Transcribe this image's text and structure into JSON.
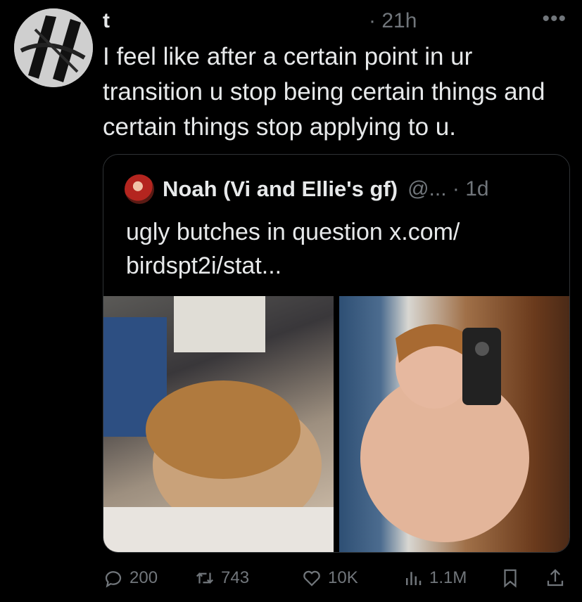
{
  "tweet": {
    "author_name": "t",
    "time": "· 21h",
    "text": "I feel like after a certain point in ur transition u stop being certain things and certain things stop applying to u.",
    "more_icon": "more-icon"
  },
  "quoted": {
    "author_name": "Noah (Vi and Ellie's gf)",
    "handle_time": "@... · 1d",
    "text": "ugly butches in question x.com/ birdspt2i/stat..."
  },
  "actions": {
    "replies": "200",
    "reposts": "743",
    "likes": "10K",
    "views": "1.1M"
  },
  "colors": {
    "background": "#000000",
    "text": "#e7e9ea",
    "muted": "#71767b",
    "border": "#2f3336"
  }
}
